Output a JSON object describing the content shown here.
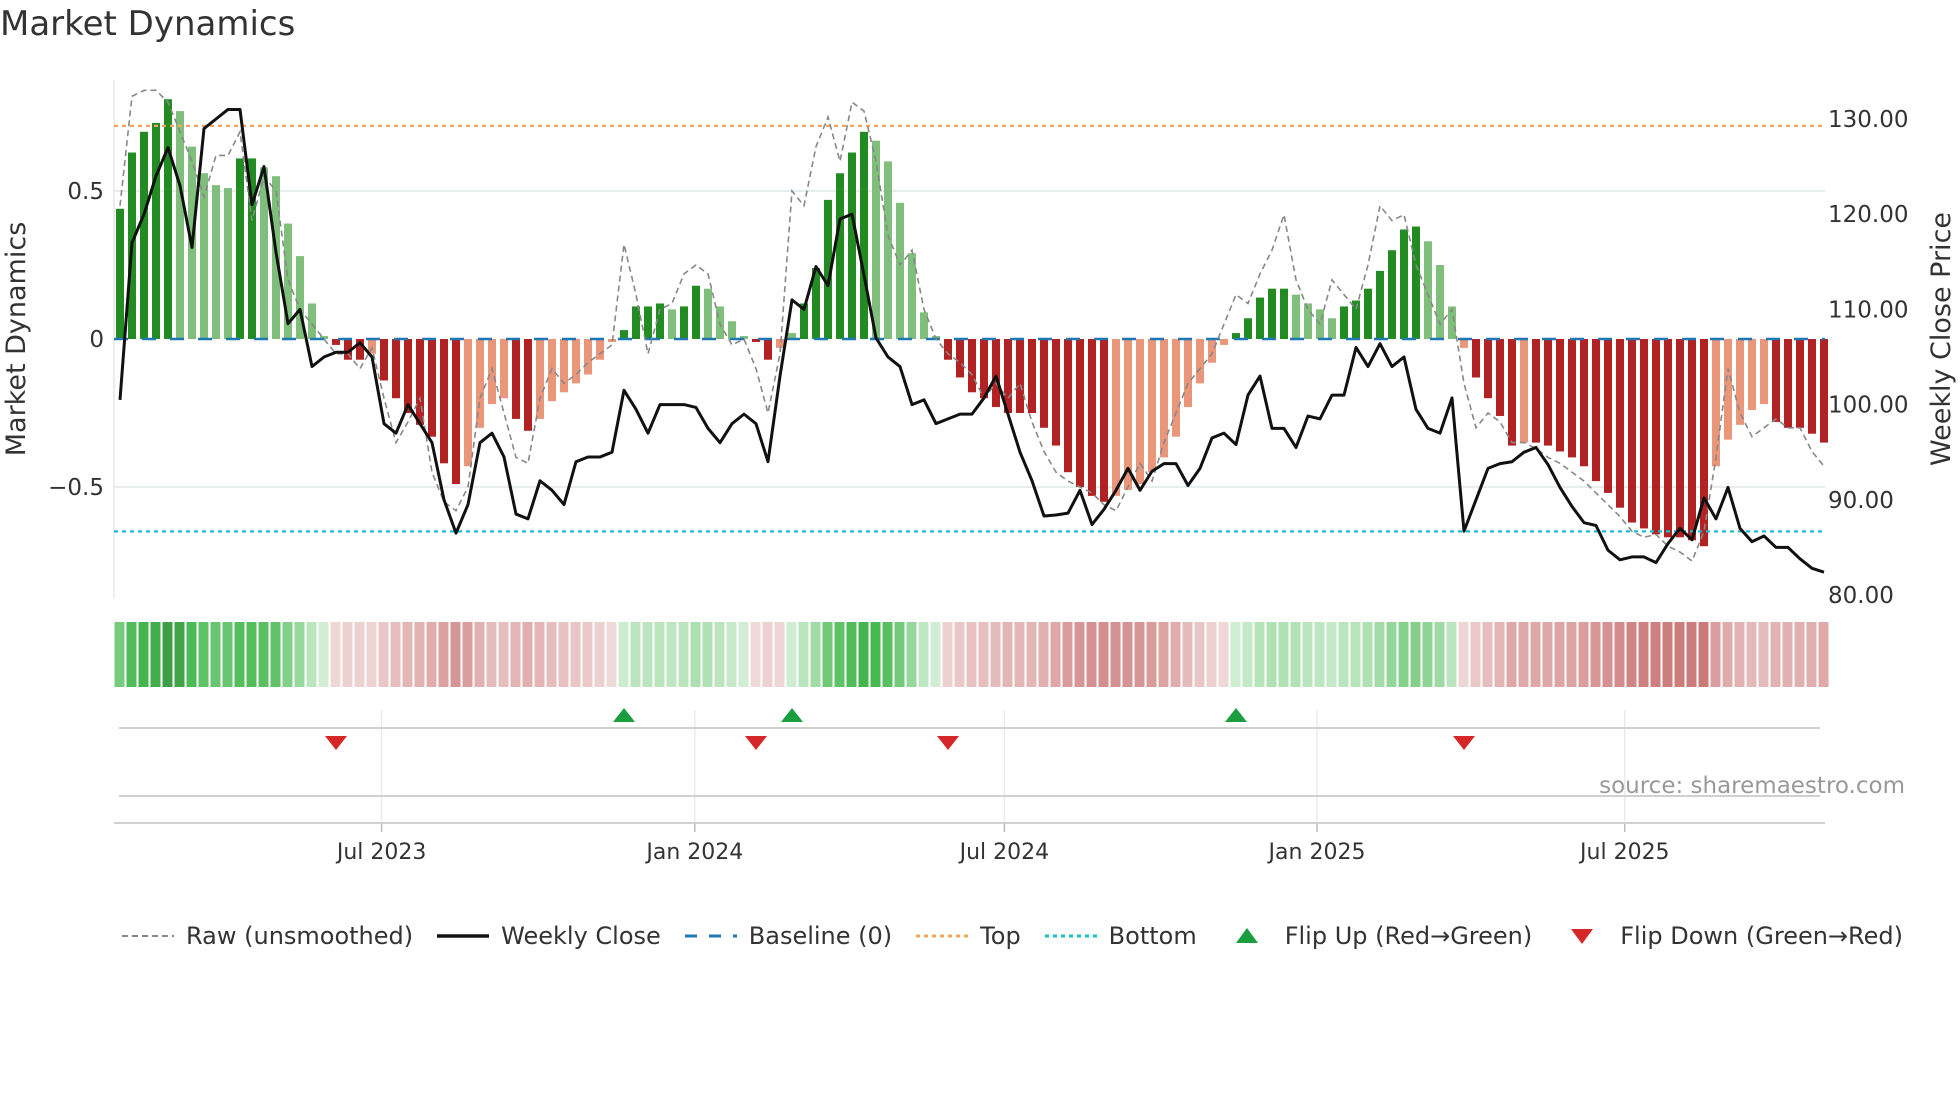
{
  "title": "Market Dynamics",
  "source": "source: sharemaestro.com",
  "chart_data": {
    "type": "bar",
    "title": "Market Dynamics",
    "ylabel": "Market Dynamics",
    "y2label": "Weekly Close Price",
    "ylim": [
      -0.88,
      0.88
    ],
    "y2lim": [
      80,
      133
    ],
    "yticks": [
      {
        "v": 0.5,
        "label": "0.5"
      },
      {
        "v": 0,
        "label": "0"
      },
      {
        "v": -0.5,
        "label": "−0.5"
      }
    ],
    "y2ticks": [
      {
        "v": 130,
        "label": "130.00"
      },
      {
        "v": 120,
        "label": "120.00"
      },
      {
        "v": 110,
        "label": "110.00"
      },
      {
        "v": 100,
        "label": "100.00"
      },
      {
        "v": 90,
        "label": "90.00"
      },
      {
        "v": 80,
        "label": "80.00"
      }
    ],
    "xticks": [
      {
        "x": 21.8,
        "label": "Jul 2023"
      },
      {
        "x": 47.9,
        "label": "Jan 2024"
      },
      {
        "x": 73.7,
        "label": "Jul 2024"
      },
      {
        "x": 99.75,
        "label": "Jan 2025"
      },
      {
        "x": 125.4,
        "label": "Jul 2025"
      }
    ],
    "top": 0.72,
    "bottom": -0.65,
    "baseline": 0,
    "bars": [
      0.44,
      0.63,
      0.7,
      0.73,
      0.81,
      0.77,
      0.65,
      0.56,
      0.52,
      0.51,
      0.61,
      0.61,
      0.58,
      0.55,
      0.39,
      0.28,
      0.12,
      0.01,
      -0.02,
      -0.07,
      -0.07,
      -0.05,
      -0.14,
      -0.2,
      -0.25,
      -0.29,
      -0.33,
      -0.42,
      -0.49,
      -0.43,
      -0.3,
      -0.22,
      -0.2,
      -0.27,
      -0.31,
      -0.27,
      -0.21,
      -0.18,
      -0.15,
      -0.12,
      -0.07,
      -0.01,
      0.03,
      0.11,
      0.11,
      0.12,
      0.1,
      0.11,
      0.18,
      0.17,
      0.11,
      0.06,
      0.01,
      -0.01,
      -0.07,
      -0.03,
      0.02,
      0.12,
      0.24,
      0.47,
      0.56,
      0.63,
      0.7,
      0.67,
      0.6,
      0.46,
      0.29,
      0.09,
      0.01,
      -0.07,
      -0.13,
      -0.18,
      -0.2,
      -0.23,
      -0.25,
      -0.25,
      -0.25,
      -0.3,
      -0.36,
      -0.45,
      -0.5,
      -0.53,
      -0.55,
      -0.53,
      -0.51,
      -0.49,
      -0.45,
      -0.4,
      -0.33,
      -0.23,
      -0.15,
      -0.08,
      -0.02,
      0.02,
      0.07,
      0.14,
      0.17,
      0.17,
      0.15,
      0.12,
      0.1,
      0.07,
      0.11,
      0.13,
      0.17,
      0.23,
      0.3,
      0.37,
      0.38,
      0.33,
      0.25,
      0.11,
      -0.03,
      -0.13,
      -0.2,
      -0.26,
      -0.36,
      -0.35,
      -0.35,
      -0.36,
      -0.38,
      -0.4,
      -0.43,
      -0.48,
      -0.52,
      -0.57,
      -0.62,
      -0.64,
      -0.66,
      -0.67,
      -0.67,
      -0.68,
      -0.7,
      -0.43,
      -0.34,
      -0.29,
      -0.24,
      -0.22,
      -0.28,
      -0.3,
      -0.3,
      -0.32,
      -0.35
    ],
    "raw": [
      0.45,
      0.82,
      0.84,
      0.84,
      0.8,
      0.7,
      0.6,
      0.48,
      0.62,
      0.62,
      0.7,
      0.4,
      0.55,
      0.5,
      0.2,
      0.1,
      0.05,
      0.0,
      -0.05,
      -0.05,
      -0.1,
      -0.03,
      -0.2,
      -0.35,
      -0.28,
      -0.2,
      -0.45,
      -0.55,
      -0.58,
      -0.5,
      -0.2,
      -0.1,
      -0.25,
      -0.4,
      -0.42,
      -0.2,
      -0.1,
      -0.15,
      -0.12,
      -0.08,
      -0.05,
      -0.02,
      0.32,
      0.15,
      -0.05,
      0.1,
      0.12,
      0.22,
      0.25,
      0.22,
      0.05,
      -0.02,
      0.0,
      -0.1,
      -0.25,
      -0.05,
      0.5,
      0.45,
      0.65,
      0.75,
      0.6,
      0.8,
      0.77,
      0.6,
      0.35,
      0.25,
      0.3,
      0.1,
      0.0,
      -0.05,
      -0.08,
      -0.12,
      -0.2,
      -0.15,
      -0.2,
      -0.15,
      -0.28,
      -0.38,
      -0.45,
      -0.48,
      -0.5,
      -0.52,
      -0.56,
      -0.58,
      -0.5,
      -0.42,
      -0.48,
      -0.35,
      -0.25,
      -0.15,
      -0.1,
      -0.05,
      0.05,
      0.15,
      0.12,
      0.22,
      0.3,
      0.42,
      0.2,
      0.1,
      0.05,
      0.2,
      0.15,
      0.1,
      0.25,
      0.45,
      0.4,
      0.42,
      0.25,
      0.15,
      0.05,
      0.1,
      -0.15,
      -0.3,
      -0.25,
      -0.28,
      -0.35,
      -0.35,
      -0.37,
      -0.4,
      -0.42,
      -0.45,
      -0.48,
      -0.52,
      -0.56,
      -0.6,
      -0.65,
      -0.67,
      -0.66,
      -0.7,
      -0.72,
      -0.75,
      -0.65,
      -0.4,
      -0.1,
      -0.25,
      -0.33,
      -0.3,
      -0.27,
      -0.3,
      -0.3,
      -0.38,
      -0.43
    ],
    "close": [
      100.5,
      117,
      120,
      124,
      127,
      123,
      116.5,
      129,
      130,
      131,
      131,
      121,
      125,
      116,
      108.5,
      110,
      104,
      105,
      105.5,
      105.5,
      106.5,
      105,
      98,
      97,
      100,
      98,
      96,
      90,
      86.5,
      89.5,
      96,
      97,
      94.5,
      88.5,
      88,
      92,
      91,
      89.5,
      94,
      94.5,
      94.5,
      95,
      101.5,
      99.5,
      97,
      100,
      100,
      100,
      99.7,
      97.5,
      96,
      98,
      99,
      98,
      94,
      103,
      111,
      110,
      114.5,
      112.5,
      119.5,
      120,
      113.6,
      107,
      105,
      104,
      100,
      100.5,
      98,
      98.5,
      99,
      99,
      100.7,
      103,
      99,
      95,
      92,
      88.3,
      88.4,
      88.6,
      91,
      87.4,
      89,
      91,
      93.3,
      91,
      93,
      93.8,
      93.8,
      91.5,
      93.3,
      96.5,
      97,
      95.8,
      101,
      103,
      97.5,
      97.5,
      95.5,
      98.8,
      98.5,
      101,
      101,
      106,
      104,
      106.4,
      104,
      105,
      99.5,
      97.5,
      97,
      100.7,
      86.7,
      90,
      93.3,
      93.8,
      94,
      95,
      95.5,
      93.7,
      91.3,
      89.3,
      87.6,
      87.3,
      84.7,
      83.7,
      84,
      84,
      83.4,
      85.4,
      87,
      85.8,
      90.2,
      88,
      91.3,
      87,
      85.6,
      86.2,
      85,
      85,
      83.8,
      82.8,
      82.4
    ],
    "flip_up": [
      42,
      56,
      93
    ],
    "flip_down": [
      18,
      53,
      69,
      112
    ],
    "colors": {
      "green_dark": "#228b22",
      "green_light": "#7fbf7b",
      "red_dark": "#b22222",
      "red_light": "#e9967a",
      "close": "#111111",
      "raw": "#888888",
      "baseline": "#1f77b4",
      "top": "#f4a460",
      "bottom": "#17becf",
      "flip_up": "#1a9e40",
      "flip_down": "#d62728"
    },
    "legend": [
      {
        "key": "raw",
        "label": "Raw (unsmoothed)"
      },
      {
        "key": "close",
        "label": "Weekly Close"
      },
      {
        "key": "baseline",
        "label": "Baseline (0)"
      },
      {
        "key": "top",
        "label": "Top"
      },
      {
        "key": "bottom",
        "label": "Bottom"
      },
      {
        "key": "flip_up",
        "label": "Flip Up (Red→Green)"
      },
      {
        "key": "flip_down",
        "label": "Flip Down (Green→Red)"
      }
    ]
  }
}
